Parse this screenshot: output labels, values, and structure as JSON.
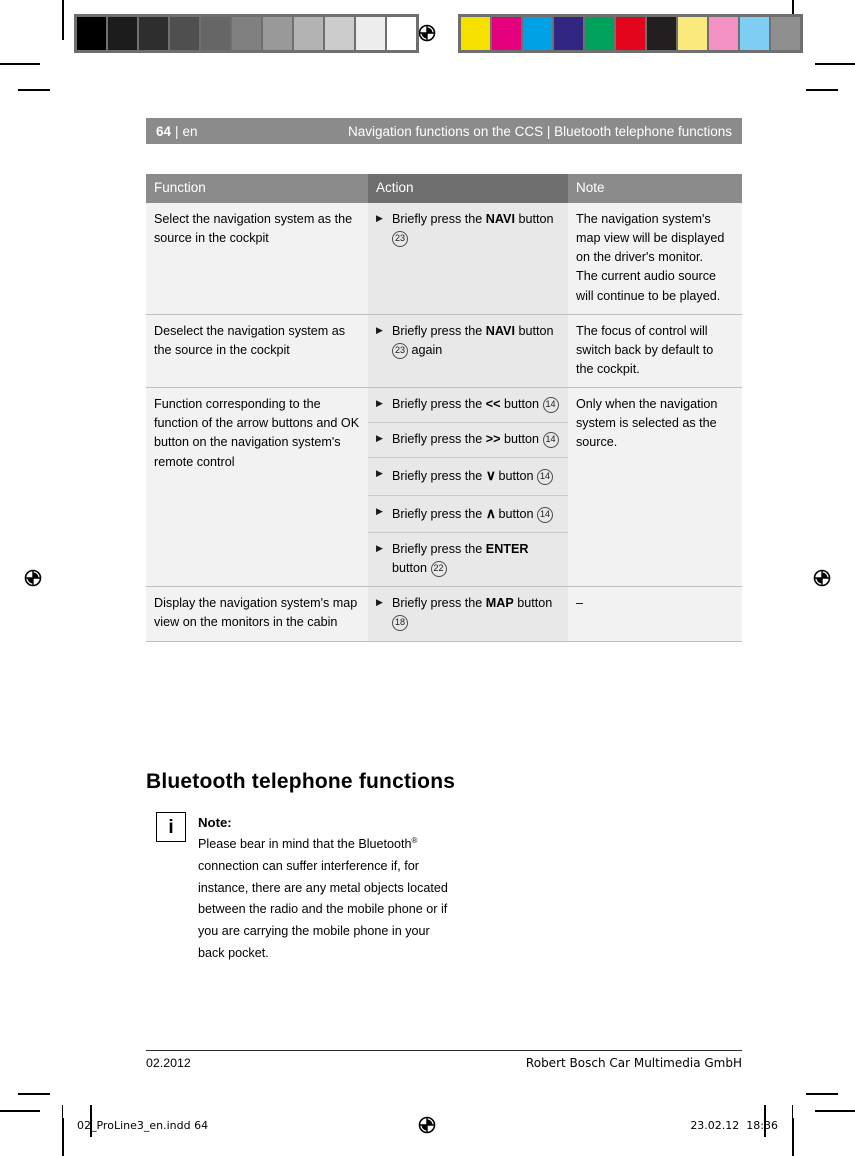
{
  "header": {
    "page_number": "64",
    "separator": "|",
    "language": "en",
    "chapter": "Navigation functions on the CCS | Bluetooth telephone functions"
  },
  "table": {
    "columns": [
      "Function",
      "Action",
      "Note"
    ],
    "rows": [
      {
        "function": "Select the navigation system as the source in the cockpit",
        "actions": [
          {
            "marker": "▶",
            "prefix": "Briefly press the ",
            "key": "NAVI",
            "mid": " button ",
            "ref": "23",
            "suffix": ""
          }
        ],
        "note": "The navigation system's map view will be displayed on the driver's monitor.\nThe current audio source will continue to be played."
      },
      {
        "function": "Deselect the navigation system as the source in the cockpit",
        "actions": [
          {
            "marker": "▶",
            "prefix": "Briefly press the ",
            "key": "NAVI",
            "mid": " button ",
            "ref": "23",
            "suffix": " again"
          }
        ],
        "note": "The focus of control will switch back by default to the cockpit."
      },
      {
        "function": "Function corresponding to the function of the arrow buttons and OK button on the navigation system's remote control",
        "actions": [
          {
            "marker": "▶",
            "prefix": "Briefly press the ",
            "key": "<<",
            "mid": " button ",
            "ref": "14",
            "suffix": ""
          },
          {
            "marker": "▶",
            "prefix": "Briefly press the ",
            "key": ">>",
            "mid": " button ",
            "ref": "14",
            "suffix": ""
          },
          {
            "marker": "▶",
            "prefix": "Briefly press the ",
            "key": "∨",
            "mid": " button ",
            "ref": "14",
            "suffix": ""
          },
          {
            "marker": "▶",
            "prefix": "Briefly press the ",
            "key": "∧",
            "mid": " button ",
            "ref": "14",
            "suffix": ""
          },
          {
            "marker": "▶",
            "prefix": "Briefly press the ",
            "key": "ENTER",
            "mid": " button ",
            "ref": "22",
            "suffix": ""
          }
        ],
        "note": "Only when the navigation system is selected as the source."
      },
      {
        "function": "Display the navigation system's map view on the monitors in the cabin",
        "actions": [
          {
            "marker": "▶",
            "prefix": "Briefly press the ",
            "key": "MAP",
            "mid": " button ",
            "ref": "18",
            "suffix": ""
          }
        ],
        "note": "–"
      }
    ]
  },
  "section": {
    "heading": "Bluetooth telephone functions"
  },
  "note_box": {
    "icon_glyph": "i",
    "title": "Note:",
    "text_before_sup": "Please bear in mind that the Bluetooth",
    "superscript": "®",
    "text_after_sup": " connection can suffer interference if, for instance, there are any metal objects located between the radio and the mobile phone or if you are carrying the mobile phone in your back pocket."
  },
  "footer": {
    "date": "02.2012",
    "company": "Robert Bosch Car Multimedia GmbH"
  },
  "print_bar": {
    "filename": "02_ProLine3_en.indd   64",
    "date": "23.02.12",
    "time": "18:36"
  },
  "calibration": {
    "gray_ramp": [
      "#000000",
      "#1c1c1c",
      "#2e2e2e",
      "#4f4f4f",
      "#666666",
      "#808080",
      "#999999",
      "#b3b3b3",
      "#cccccc",
      "#ededed",
      "#ffffff"
    ],
    "color_swatches": [
      "#f5e000",
      "#e5007d",
      "#00a0e4",
      "#312783",
      "#00a25b",
      "#e3051b",
      "#231f20",
      "#faea7e",
      "#f390c4",
      "#7ecdf2",
      "#8f8f8f"
    ]
  },
  "colors": {
    "header_bar": "#8b8b8b",
    "table_header_light": "#8b8b8b",
    "table_header_dark": "#6e6e6e",
    "cell_light": "#f2f2f2",
    "cell_mid": "#e8e8e8",
    "rule": "#bfbfbf"
  }
}
